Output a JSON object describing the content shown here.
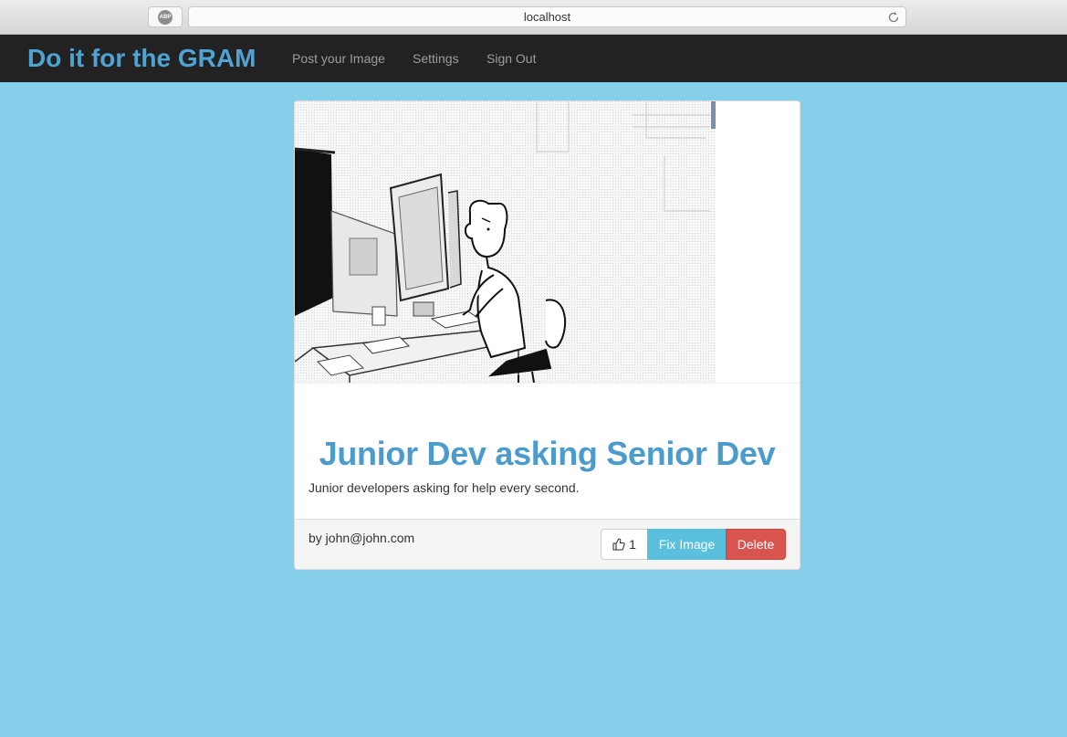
{
  "browser": {
    "url": "localhost",
    "adblock_badge": "ABP"
  },
  "navbar": {
    "brand": "Do it for the GRAM",
    "links": [
      "Post your Image",
      "Settings",
      "Sign Out"
    ]
  },
  "post": {
    "title": "Junior Dev asking Senior Dev",
    "description": "Junior developers asking for help every second.",
    "author": "by john@john.com",
    "likes": "1",
    "fix_label": "Fix Image",
    "delete_label": "Delete"
  },
  "colors": {
    "page_background": "#87ceeb",
    "navbar": "#222222",
    "brand": "#4ea3d3",
    "title": "#4b9ccc",
    "fix_button": "#5bc0de",
    "delete_button": "#d9534f"
  }
}
